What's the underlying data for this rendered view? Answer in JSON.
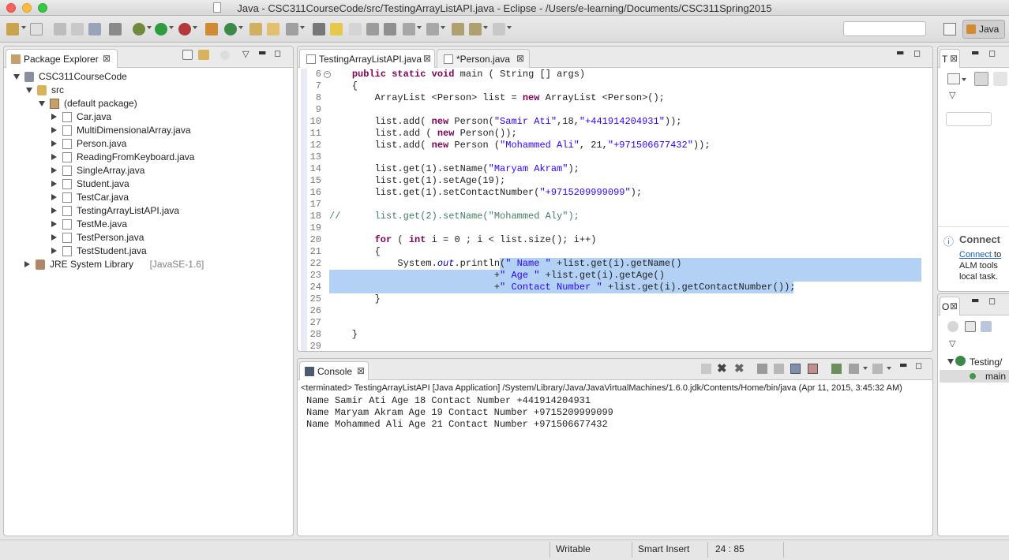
{
  "window": {
    "title": "Java - CSC311CourseCode/src/TestingArrayListAPI.java - Eclipse - /Users/e-learning/Documents/CSC311Spring2015"
  },
  "toolbar": {
    "perspective_label": "Java",
    "quick_access_placeholder": ""
  },
  "package_explorer": {
    "tab_label": "Package Explorer",
    "tree": [
      {
        "label": "CSC311CourseCode",
        "level": 0,
        "icon": "project-icon",
        "expanded": true
      },
      {
        "label": "src",
        "level": 1,
        "icon": "source-folder-icon",
        "expanded": true
      },
      {
        "label": "(default package)",
        "level": 2,
        "icon": "package-icon",
        "expanded": true
      },
      {
        "label": "Car.java",
        "level": 3,
        "icon": "java-file-icon",
        "expanded": false
      },
      {
        "label": "MultiDimensionalArray.java",
        "level": 3,
        "icon": "java-file-icon",
        "expanded": false
      },
      {
        "label": "Person.java",
        "level": 3,
        "icon": "java-file-icon",
        "expanded": false
      },
      {
        "label": "ReadingFromKeyboard.java",
        "level": 3,
        "icon": "java-file-icon",
        "expanded": false
      },
      {
        "label": "SingleArray.java",
        "level": 3,
        "icon": "java-file-icon",
        "expanded": false
      },
      {
        "label": "Student.java",
        "level": 3,
        "icon": "java-file-icon",
        "expanded": false
      },
      {
        "label": "TestCar.java",
        "level": 3,
        "icon": "java-file-icon",
        "expanded": false
      },
      {
        "label": "TestingArrayListAPI.java",
        "level": 3,
        "icon": "java-file-icon",
        "expanded": false
      },
      {
        "label": "TestMe.java",
        "level": 3,
        "icon": "java-file-icon",
        "expanded": false
      },
      {
        "label": "TestPerson.java",
        "level": 3,
        "icon": "java-file-icon",
        "expanded": false
      },
      {
        "label": "TestStudent.java",
        "level": 3,
        "icon": "java-file-icon",
        "expanded": false
      },
      {
        "label": "JRE System Library",
        "suffix": "[JavaSE-1.6]",
        "level": 0,
        "icon": "library-icon",
        "expanded": false
      }
    ]
  },
  "editor": {
    "tabs": [
      {
        "label": "TestingArrayListAPI.java",
        "active": true
      },
      {
        "label": "*Person.java",
        "active": false
      }
    ],
    "lines": [
      {
        "n": "6",
        "text": "    public static void main ( String [] args)"
      },
      {
        "n": "7",
        "text": "    {"
      },
      {
        "n": "8",
        "text": "        ArrayList <Person> list = new ArrayList <Person>();"
      },
      {
        "n": "9",
        "text": ""
      },
      {
        "n": "10",
        "text": "        list.add( new Person(\"Samir Ati\",18,\"+441914204931\"));"
      },
      {
        "n": "11",
        "text": "        list.add ( new Person());"
      },
      {
        "n": "12",
        "text": "        list.add( new Person (\"Mohammed Ali\", 21,\"+971506677432\"));"
      },
      {
        "n": "13",
        "text": ""
      },
      {
        "n": "14",
        "text": "        list.get(1).setName(\"Maryam Akram\");"
      },
      {
        "n": "15",
        "text": "        list.get(1).setAge(19);"
      },
      {
        "n": "16",
        "text": "        list.get(1).setContactNumber(\"+9715209999099\");"
      },
      {
        "n": "17",
        "text": ""
      },
      {
        "n": "18",
        "text": "//      list.get(2).setName(\"Mohammed Aly\");"
      },
      {
        "n": "19",
        "text": ""
      },
      {
        "n": "20",
        "text": "        for ( int i = 0 ; i < list.size(); i++)"
      },
      {
        "n": "21",
        "text": "        {"
      },
      {
        "n": "22",
        "text": "            System.out.println(\" Name \" +list.get(i).getName()"
      },
      {
        "n": "23",
        "text": "                             +\" Age \" +list.get(i).getAge()"
      },
      {
        "n": "24",
        "text": "                             +\" Contact Number \" +list.get(i).getContactNumber());"
      },
      {
        "n": "25",
        "text": "        }"
      },
      {
        "n": "26",
        "text": ""
      },
      {
        "n": "27",
        "text": ""
      },
      {
        "n": "28",
        "text": "    }"
      },
      {
        "n": "29",
        "text": ""
      }
    ]
  },
  "console": {
    "tab_label": "Console",
    "header": "<terminated> TestingArrayListAPI [Java Application] /System/Library/Java/JavaVirtualMachines/1.6.0.jdk/Contents/Home/bin/java (Apr 11, 2015, 3:45:32 AM)",
    "output": [
      "Name Samir Ati Age 18 Contact Number +441914204931",
      "Name Maryam Akram Age 19 Contact Number +9715209999099",
      "Name Mohammed Ali Age 21 Contact Number +971506677432"
    ]
  },
  "right_panels": {
    "task_tab_label": "T",
    "connect_title": "Connect",
    "connect_link": "Connect",
    "connect_link_suffix": " to",
    "connect_line2": "ALM tools",
    "connect_line3": "local task.",
    "outline_tab_label": "O",
    "outline_item1": "Testing/",
    "outline_item2": "main"
  },
  "statusbar": {
    "writable": "Writable",
    "insert_mode": "Smart Insert",
    "position": "24 : 85"
  },
  "colors": {
    "selection": "#b3d1f5",
    "keyword": "#7f0055",
    "string": "#2a00ff",
    "comment": "#3f7f5f"
  }
}
